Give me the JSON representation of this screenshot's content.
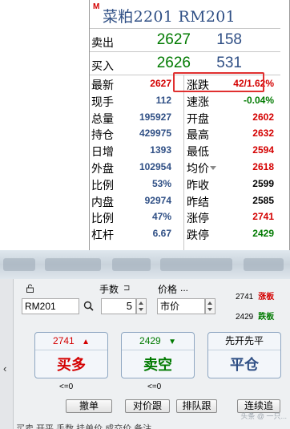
{
  "quote": {
    "marker": "M",
    "title": "菜粕2201  RM201",
    "ask": {
      "label": "卖出",
      "price": "2627",
      "volume": "158"
    },
    "bid": {
      "label": "买入",
      "price": "2626",
      "volume": "531"
    },
    "rows": [
      {
        "l1": "最新",
        "v1": "2627",
        "l2": "涨跌",
        "v2": "42/1.62%"
      },
      {
        "l1": "现手",
        "v1": "112",
        "l2": "速涨",
        "v2": "-0.04%"
      },
      {
        "l1": "总量",
        "v1": "195927",
        "l2": "开盘",
        "v2": "2602"
      },
      {
        "l1": "持仓",
        "v1": "429975",
        "l2": "最高",
        "v2": "2632"
      },
      {
        "l1": "日增",
        "v1": "1393",
        "l2": "最低",
        "v2": "2594"
      },
      {
        "l1": "外盘",
        "v1": "102954",
        "l2": "均价",
        "v2": "2618"
      },
      {
        "l1": "比例",
        "v1": "53%",
        "l2": "昨收",
        "v2": "2599"
      },
      {
        "l1": "内盘",
        "v1": "92974",
        "l2": "昨结",
        "v2": "2585"
      },
      {
        "l1": "比例",
        "v1": "47%",
        "l2": "涨停",
        "v2": "2741"
      },
      {
        "l1": "杠杆",
        "v1": "6.67",
        "l2": "跌停",
        "v2": "2429"
      }
    ]
  },
  "trade": {
    "qty_label": "手数",
    "price_label": "价格",
    "price_more": "...",
    "contract_value": "RM201",
    "qty_value": "5",
    "price_value": "市价",
    "limit_up": {
      "price": "2741",
      "label": "涨板"
    },
    "limit_down": {
      "price": "2429",
      "label": "跌板"
    },
    "buy": {
      "price": "2741",
      "label": "买多",
      "arrow": "▲",
      "le0": "<=0"
    },
    "sell": {
      "price": "2429",
      "label": "卖空",
      "arrow": "▼",
      "le0": "<=0"
    },
    "close": {
      "top": "先开先平",
      "label": "平仓"
    },
    "actions": {
      "cancel": "撤单",
      "opp": "对价跟",
      "queue": "排队跟",
      "chase": "连续追"
    },
    "left_arrow": "‹",
    "bottom_cut": "买卖  开平  手数  挂单价  成交价  备注",
    "watermark": "头条 @ 一只..."
  },
  "colors": {
    "up": "#d40000",
    "down": "#007a00",
    "neutral": "#2f4f85"
  }
}
